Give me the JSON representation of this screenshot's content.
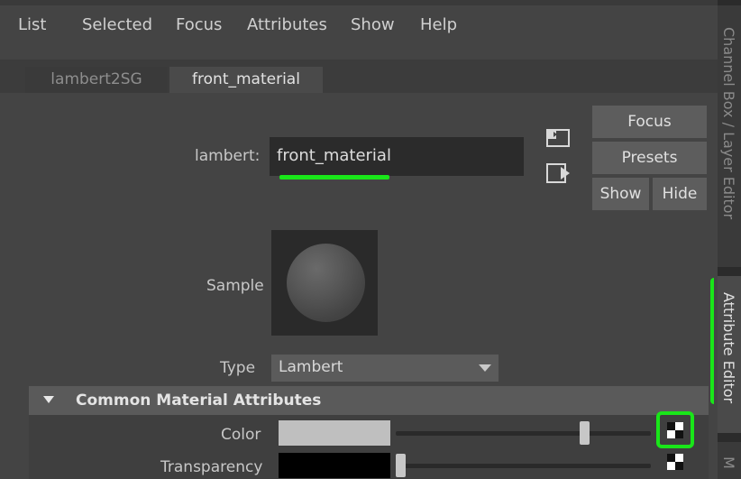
{
  "menu": [
    "List",
    "Selected",
    "Focus",
    "Attributes",
    "Show",
    "Help"
  ],
  "tabs": [
    "lambert2SG",
    "front_material"
  ],
  "node": {
    "type_label": "lambert:",
    "name": "front_material"
  },
  "buttons": {
    "focus": "Focus",
    "presets": "Presets",
    "show": "Show",
    "hide": "Hide"
  },
  "sample_label": "Sample",
  "type": {
    "label": "Type",
    "value": "Lambert"
  },
  "section": {
    "title": "Common Material Attributes"
  },
  "attributes": {
    "color": {
      "label": "Color",
      "swatch_color": "#bfbfbf",
      "slider_fraction": 0.75
    },
    "transparency": {
      "label": "Transparency",
      "swatch_color": "#000000",
      "slider_fraction": 0.0
    }
  },
  "side_tabs": {
    "channel_box": "Channel Box / Layer Editor",
    "attribute_editor": "Attribute Editor",
    "other": "M"
  },
  "colors": {
    "highlight_green": "#19e619",
    "panel_bg": "#444444"
  },
  "icons": [
    "input-connections-icon",
    "output-connections-icon",
    "map-texture-icon",
    "dropdown-arrow-icon",
    "collapse-triangle-icon"
  ]
}
